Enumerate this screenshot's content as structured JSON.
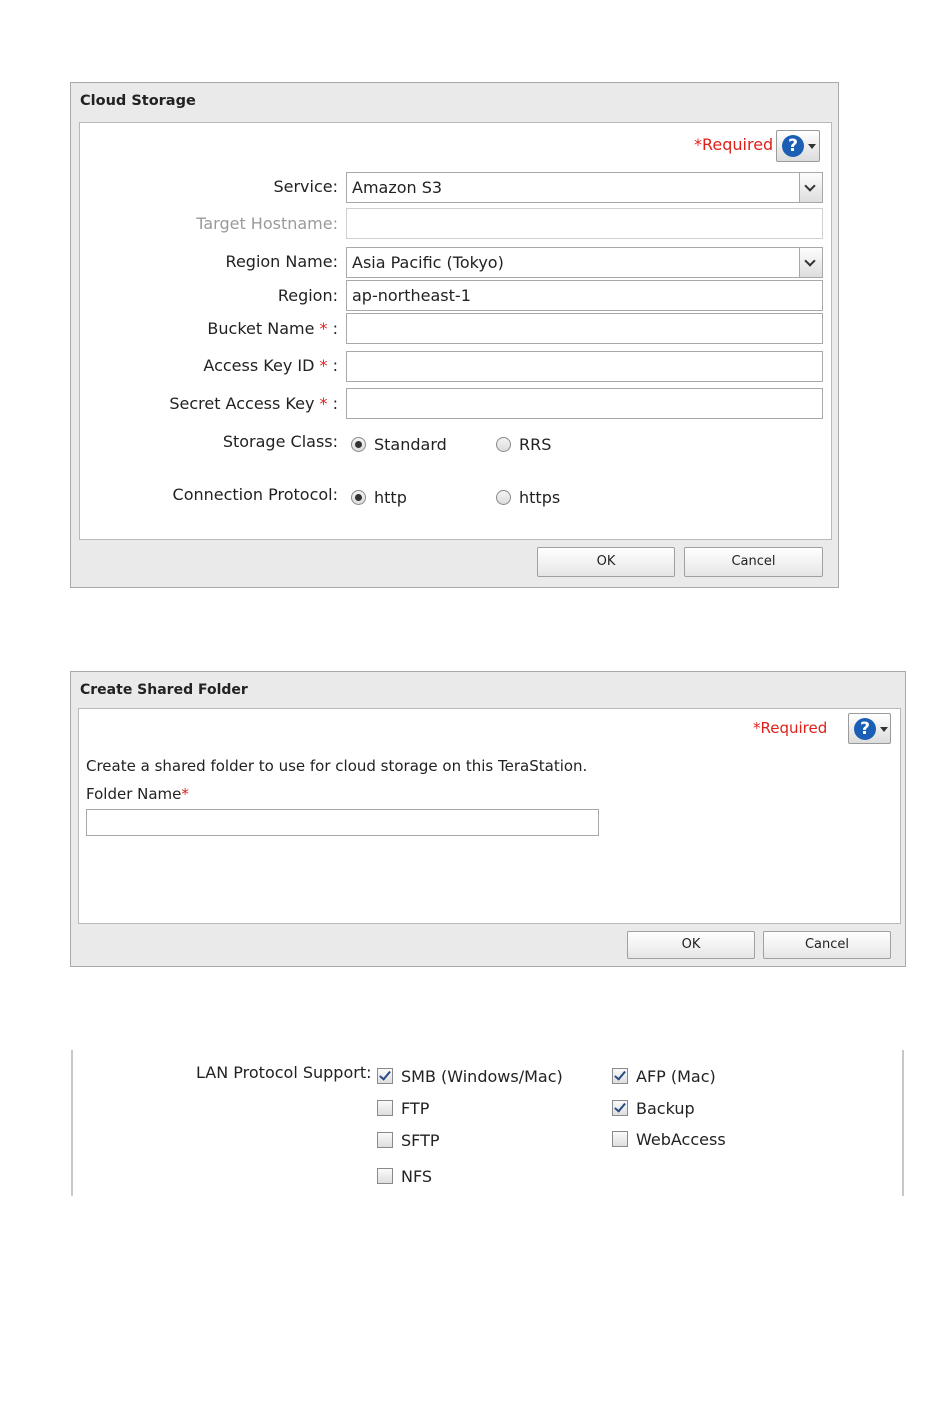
{
  "cloud_storage": {
    "title": "Cloud Storage",
    "required_note": "*Required",
    "help_icon": "question-icon",
    "fields": {
      "service_label": "Service:",
      "service_value": "Amazon S3",
      "target_hostname_label": "Target Hostname:",
      "target_hostname_value": "",
      "region_name_label": "Region Name:",
      "region_name_value": "Asia Pacific (Tokyo)",
      "region_label": "Region:",
      "region_value": "ap-northeast-1",
      "bucket_name_label": "Bucket Name",
      "bucket_name_value": "",
      "access_key_label": "Access Key ID",
      "access_key_value": "",
      "secret_key_label": "Secret Access Key",
      "secret_key_value": "",
      "required_star": "*",
      "colon": ":"
    },
    "storage_class": {
      "label": "Storage Class:",
      "options": [
        "Standard",
        "RRS"
      ],
      "selected": "Standard"
    },
    "connection_protocol": {
      "label": "Connection Protocol:",
      "options": [
        "http",
        "https"
      ],
      "selected": "http"
    },
    "ok_label": "OK",
    "cancel_label": "Cancel"
  },
  "create_shared_folder": {
    "title": "Create Shared Folder",
    "required_note": "*Required",
    "help_icon": "question-icon",
    "description": "Create a shared folder to use for cloud storage on this TeraStation.",
    "folder_name_label": "Folder Name",
    "folder_name_star": "*",
    "folder_name_value": "",
    "ok_label": "OK",
    "cancel_label": "Cancel"
  },
  "lan_protocol": {
    "label": "LAN Protocol Support:",
    "options": [
      {
        "label": "SMB (Windows/Mac)",
        "checked": true
      },
      {
        "label": "AFP (Mac)",
        "checked": true
      },
      {
        "label": "FTP",
        "checked": false
      },
      {
        "label": "Backup",
        "checked": true
      },
      {
        "label": "SFTP",
        "checked": false
      },
      {
        "label": "WebAccess",
        "checked": false
      },
      {
        "label": "NFS",
        "checked": false
      }
    ]
  },
  "colors": {
    "required": "#e0201a",
    "help_blue": "#1a5fb4",
    "dialog_bg": "#eaeaea"
  }
}
